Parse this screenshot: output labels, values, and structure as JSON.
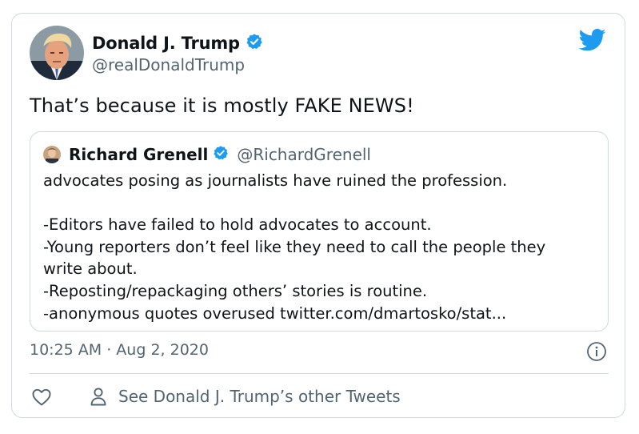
{
  "author": {
    "display_name": "Donald J. Trump",
    "handle": "@realDonaldTrump",
    "verified": true
  },
  "tweet": {
    "text": "That’s because it is mostly FAKE NEWS!",
    "timestamp": "10:25 AM · Aug 2, 2020"
  },
  "quoted_tweet": {
    "display_name": "Richard Grenell",
    "handle": "@RichardGrenell",
    "verified": true,
    "lines": [
      "advocates posing as journalists have ruined the profession.",
      "",
      "-Editors have failed to hold advocates to account.",
      "-Young reporters don’t feel like they need to call the people they",
      "write about.",
      "-Reposting/repackaging others’ stories is routine.",
      "-anonymous quotes overused twitter.com/dmartosko/stat..."
    ]
  },
  "footer": {
    "other_tweets_label": "See Donald J. Trump’s other Tweets"
  },
  "colors": {
    "brand_blue": "#1d9bf0",
    "text_primary": "#0f1419",
    "text_secondary": "#536471",
    "border": "#cfd9de"
  },
  "icons": [
    "twitter-bird-icon",
    "verified-badge-icon",
    "info-icon",
    "heart-icon",
    "person-icon"
  ]
}
